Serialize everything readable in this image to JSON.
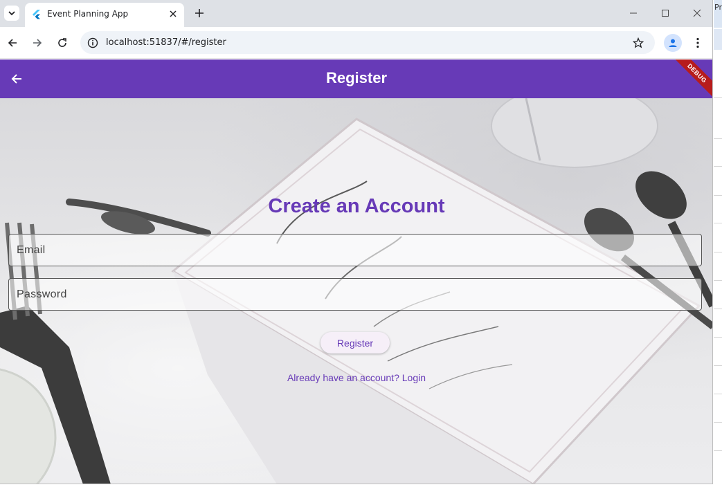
{
  "browser": {
    "tab_title": "Event Planning App",
    "url": "localhost:51837/#/register"
  },
  "app_bar": {
    "title": "Register",
    "debug_banner": "DEBUG"
  },
  "form": {
    "heading": "Create an Account",
    "email_placeholder": "Email",
    "password_placeholder": "Password",
    "submit_label": "Register",
    "login_link": "Already have an account? Login"
  },
  "side_window": {
    "peek_text": "Pr"
  },
  "colors": {
    "primary": "#673ab7",
    "debug_banner": "#b71c1c",
    "tabstrip": "#dee1e6"
  },
  "icons": {
    "back": "arrow-left-icon",
    "tab_favicon": "flutter-icon",
    "star": "star-icon",
    "profile": "person-icon"
  }
}
